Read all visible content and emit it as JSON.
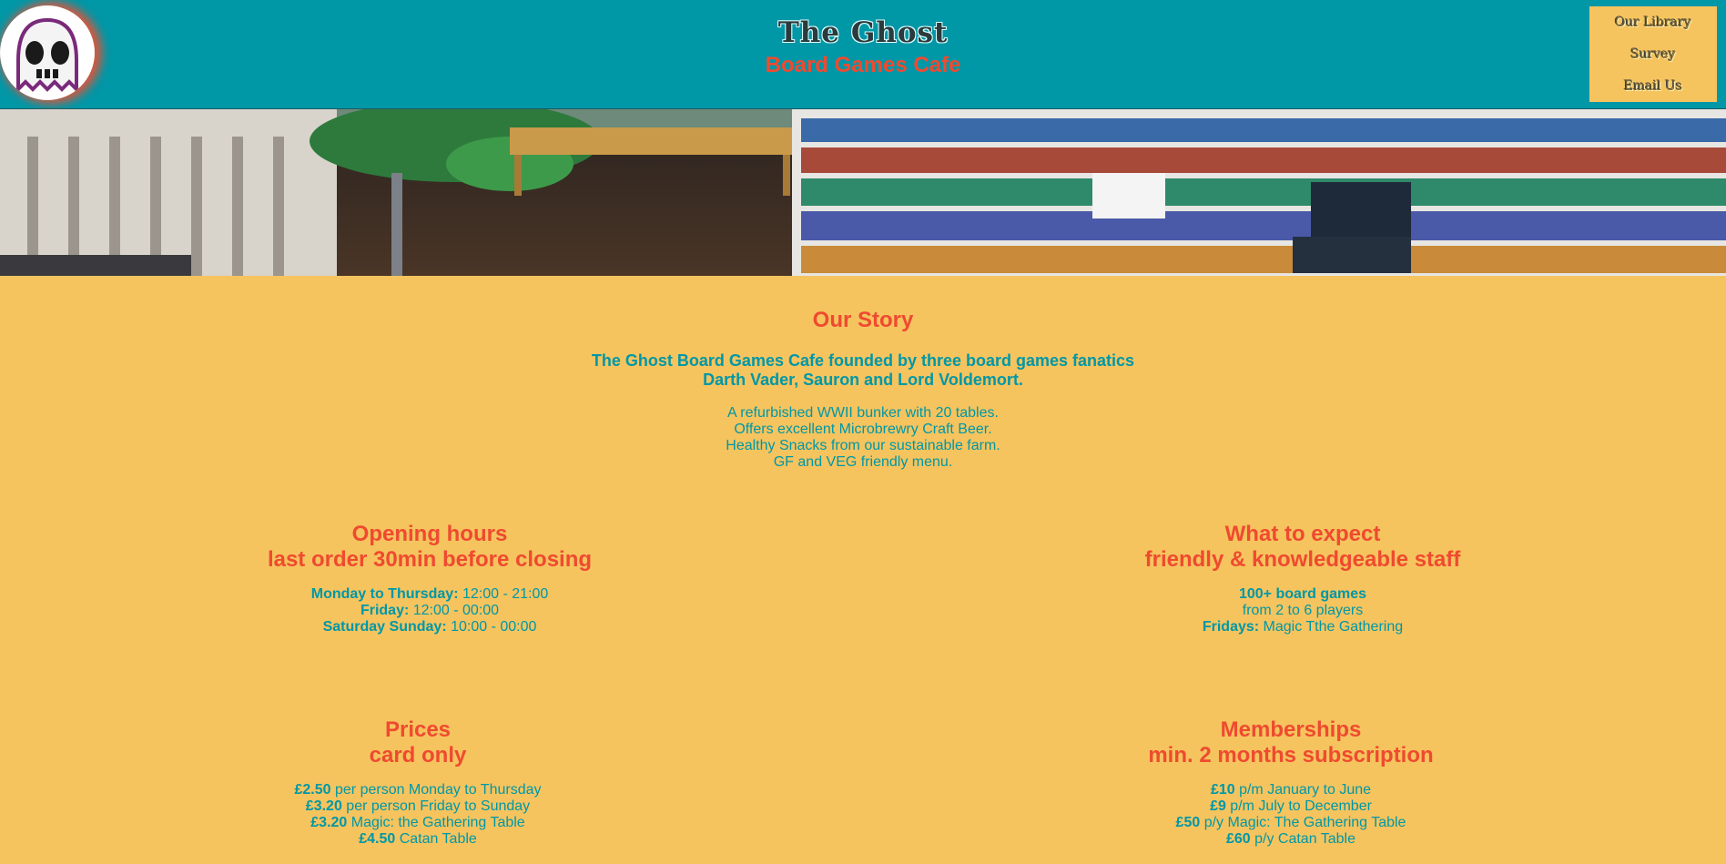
{
  "header": {
    "title": "The Ghost",
    "subtitle": "Board Games Cafe",
    "nav": [
      "Our Library",
      "Survey",
      "Email Us"
    ]
  },
  "story": {
    "heading": "Our Story",
    "lead1": "The Ghost Board Games Cafe founded by three board games fanatics",
    "lead2": "Darth Vader, Sauron and Lord Voldemort.",
    "desc": [
      "A refurbished WWII bunker with 20 tables.",
      "Offers excellent Microbrewry Craft Beer.",
      "Healthy Snacks from our sustainable farm.",
      "GF and VEG friendly menu."
    ]
  },
  "hours": {
    "heading1": "Opening hours",
    "heading2": "last order 30min before closing",
    "rows": [
      {
        "label": "Monday to Thursday:",
        "value": " 12:00 - 21:00"
      },
      {
        "label": "Friday:",
        "value": " 12:00 - 00:00"
      },
      {
        "label": "Saturday Sunday:",
        "value": " 10:00 - 00:00"
      }
    ]
  },
  "expect": {
    "heading1": "What to expect",
    "heading2": "friendly & knowledgeable staff",
    "rows": [
      {
        "label": "100+ board games",
        "value": ""
      },
      {
        "label": "",
        "value": "from 2 to 6 players"
      },
      {
        "label": "Fridays:",
        "value": " Magic Tthe Gathering"
      }
    ]
  },
  "prices": {
    "heading1": "Prices",
    "heading2": "card only",
    "rows": [
      {
        "label": "£2.50",
        "value": " per person Monday to Thursday"
      },
      {
        "label": "£3.20",
        "value": " per person Friday to Sunday"
      },
      {
        "label": "£3.20",
        "value": " Magic: the Gathering Table"
      },
      {
        "label": "£4.50",
        "value": " Catan Table"
      }
    ]
  },
  "memberships": {
    "heading1": "Memberships",
    "heading2": "min. 2 months subscription",
    "rows": [
      {
        "label": "£10",
        "value": " p/m January to June"
      },
      {
        "label": "£9",
        "value": " p/m July to December"
      },
      {
        "label": "£50",
        "value": " p/y Magic: The Gathering Table"
      },
      {
        "label": "£60",
        "value": " p/y Catan Table"
      }
    ]
  },
  "colors": {
    "teal": "#0097a7",
    "mustard": "#f5c45e",
    "coral": "#ef4a30"
  }
}
